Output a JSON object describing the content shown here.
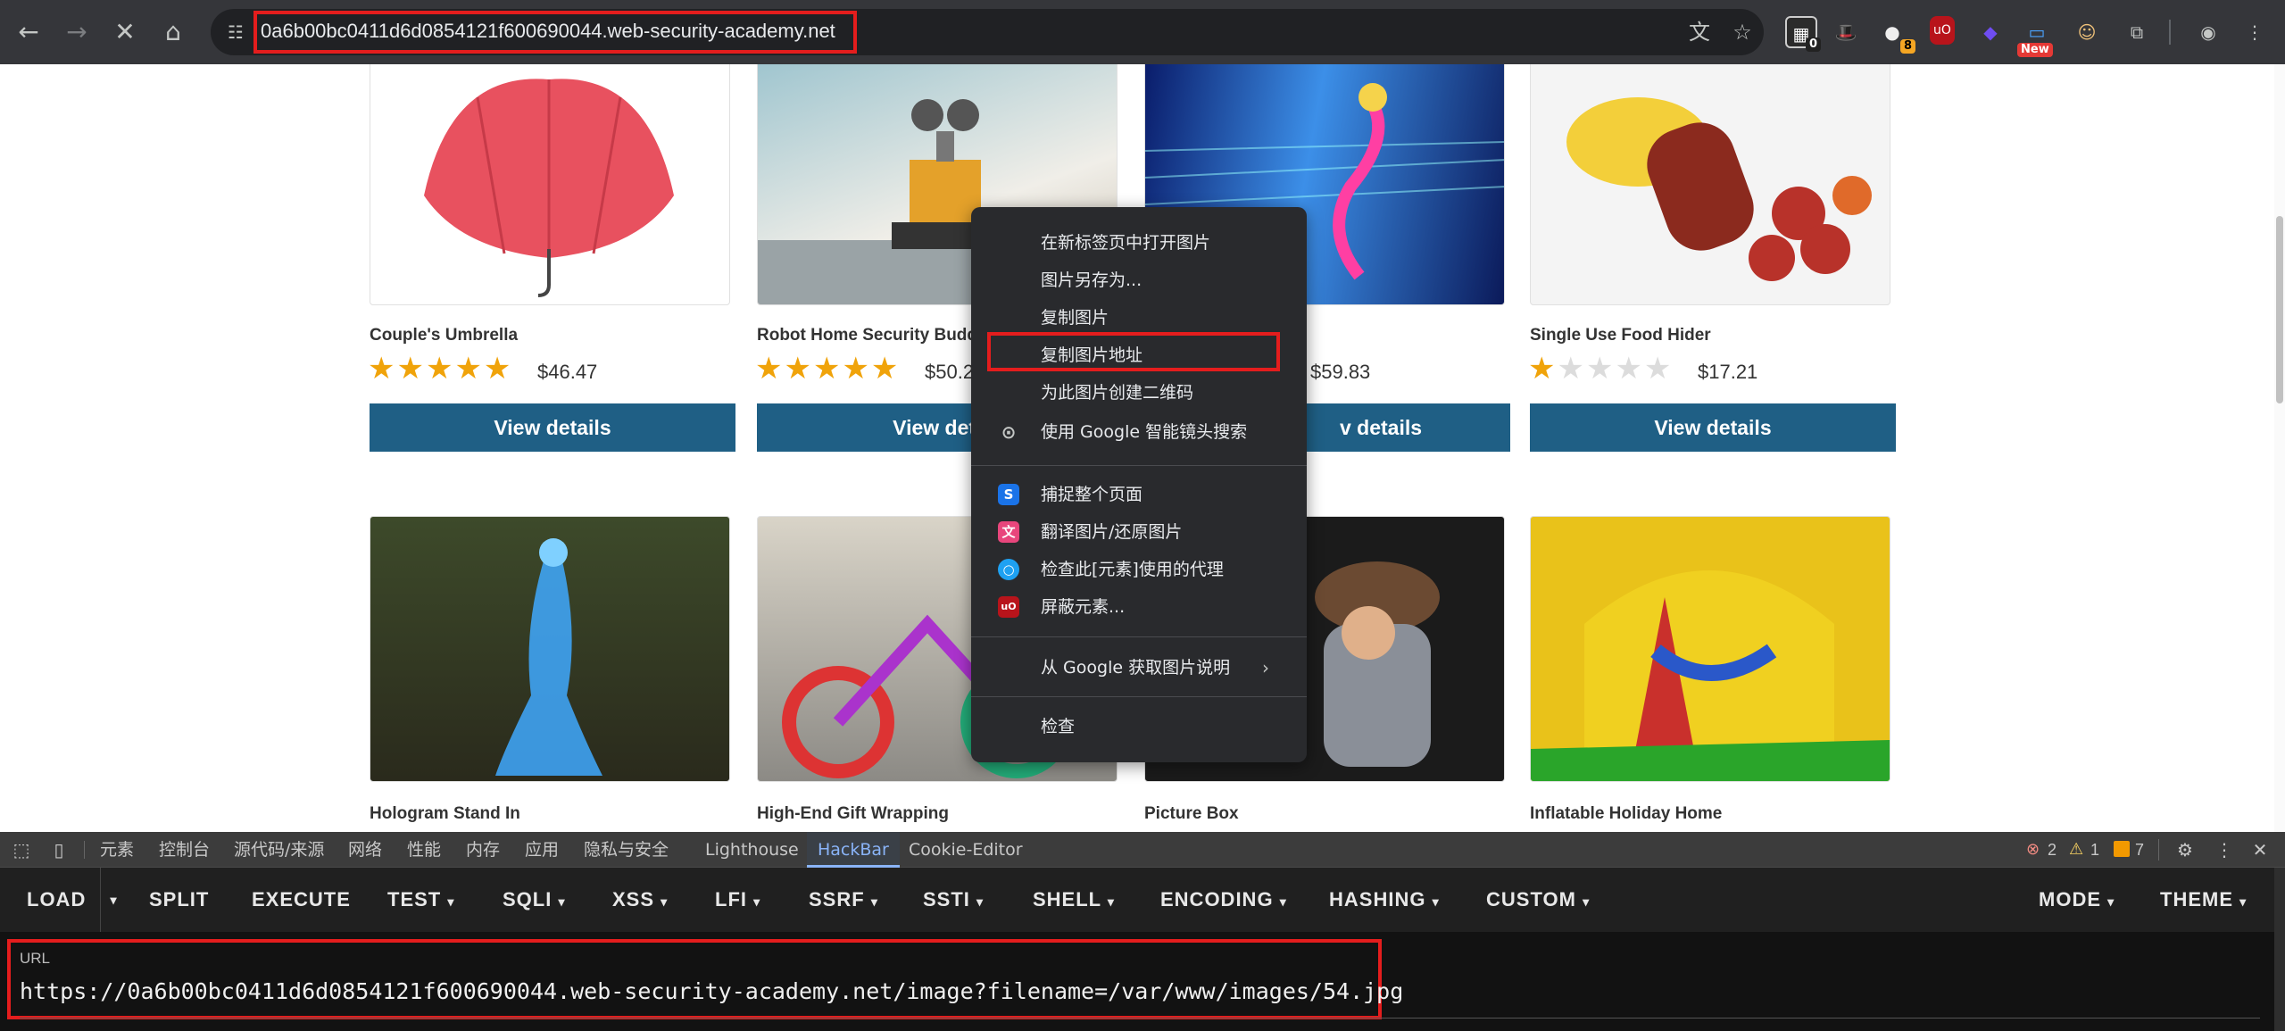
{
  "browser": {
    "url": "0a6b00bc0411d6d0854121f600690044.web-security-academy.net",
    "extension_badges": {
      "ext2": "8",
      "ext1": "0",
      "new": "New"
    }
  },
  "products_row1": [
    {
      "title": "Couple's Umbrella",
      "rating": 5,
      "price": "$46.47",
      "button": "View details"
    },
    {
      "title": "Robot Home Security Budd",
      "rating": 5,
      "price": "$50.2",
      "button": "View deta"
    },
    {
      "title": "",
      "rating": 0,
      "price": "$59.83",
      "button": "v details"
    },
    {
      "title": "Single Use Food Hider",
      "rating": 1,
      "price": "$17.21",
      "button": "View details"
    }
  ],
  "products_row2": [
    {
      "title": "Hologram Stand In"
    },
    {
      "title": "High-End Gift Wrapping"
    },
    {
      "title": "Picture Box"
    },
    {
      "title": "Inflatable Holiday Home"
    }
  ],
  "context_menu": {
    "items": [
      "在新标签页中打开图片",
      "图片另存为...",
      "复制图片",
      "复制图片地址",
      "为此图片创建二维码",
      "使用 Google 智能镜头搜索",
      "捕捉整个页面",
      "翻译图片/还原图片",
      "检查此[元素]使用的代理",
      "屏蔽元素...",
      "从 Google 获取图片说明",
      "检查"
    ]
  },
  "devtools": {
    "tabs": [
      "元素",
      "控制台",
      "源代码/来源",
      "网络",
      "性能",
      "内存",
      "应用",
      "隐私与安全",
      "Lighthouse",
      "HackBar",
      "Cookie-Editor"
    ],
    "errors": "2",
    "warnings": "1",
    "issues": "7"
  },
  "hackbar": {
    "buttons": [
      "LOAD",
      "SPLIT",
      "EXECUTE",
      "TEST",
      "SQLI",
      "XSS",
      "LFI",
      "SSRF",
      "SSTI",
      "SHELL",
      "ENCODING",
      "HASHING",
      "CUSTOM",
      "MODE",
      "THEME"
    ],
    "url_label": "URL",
    "url_value": "https://0a6b00bc0411d6d0854121f600690044.web-security-academy.net/image?filename=/var/www/images/54.jpg"
  }
}
